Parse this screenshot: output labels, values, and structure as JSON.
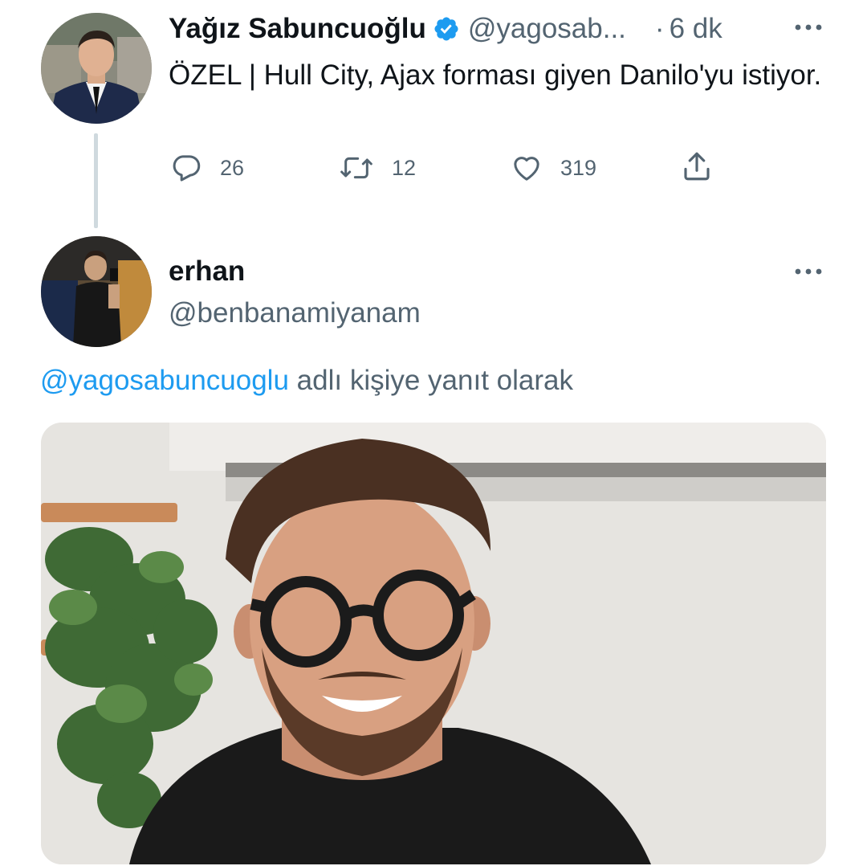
{
  "tweet": {
    "author_name": "Yağız Sabuncuoğlu",
    "author_handle": "@yagosab...",
    "separator": "·",
    "time": "6 dk",
    "text": "ÖZEL | Hull City, Ajax forması giyen Danilo'yu istiyor.",
    "verified": true,
    "actions": {
      "reply_count": "26",
      "retweet_count": "12",
      "like_count": "319"
    }
  },
  "reply": {
    "author_name": "erhan",
    "author_handle": "@benbanamiyanam",
    "replying_to_mention": "@yagosabuncuoglu",
    "replying_to_suffix": " adlı kişiye yanıt olarak"
  },
  "icons": {
    "verified": "verified-badge-icon",
    "more": "more-dots-icon",
    "reply": "reply-bubble-icon",
    "retweet": "retweet-icon",
    "like": "heart-icon",
    "share": "share-icon"
  },
  "colors": {
    "text_primary": "#0f1419",
    "text_secondary": "#536471",
    "accent": "#1d9bf0",
    "thread_line": "#cfd9de"
  }
}
